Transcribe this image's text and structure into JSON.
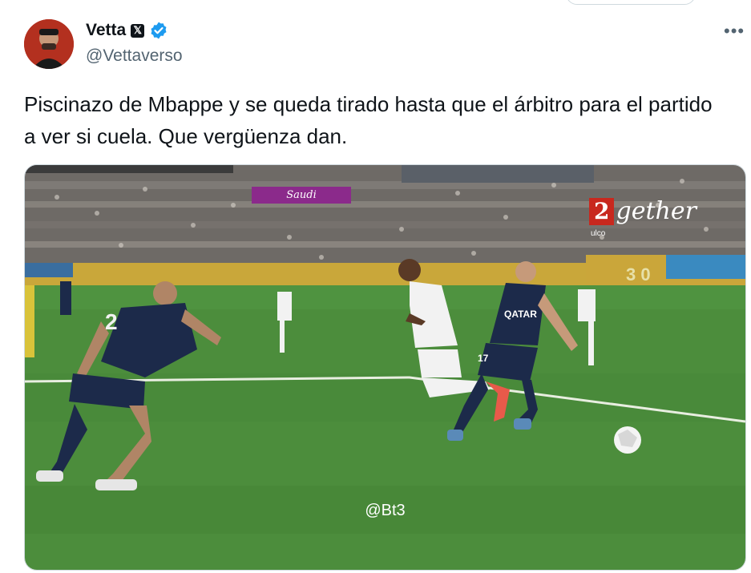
{
  "author": {
    "display_name": "Vetta",
    "handle": "@Vettaverso",
    "x_badge": "𝕏",
    "verified_icon": "verified-badge-icon",
    "avatar_icon": "avatar"
  },
  "menu": {
    "more_label": "•••"
  },
  "tweet": {
    "text": "Piscinazo de Mbappe y se queda tirado hasta que el árbitro para el partido a ver si cuela. Que vergüenza dan."
  },
  "media": {
    "watermark": "@Bt3",
    "sponsor_text": "Saudi",
    "channel_number": "2",
    "channel_word": "gether",
    "channel_sub": "ulco",
    "board_number": "3 0",
    "player_number_left": "2",
    "player_number_right": "17",
    "shirt_sponsor": "QATAR"
  },
  "colors": {
    "pitch": "#4a8a3a",
    "verified_blue": "#1d9bf0",
    "psg_navy": "#1c2a4a",
    "real_white": "#f2f2f2"
  }
}
